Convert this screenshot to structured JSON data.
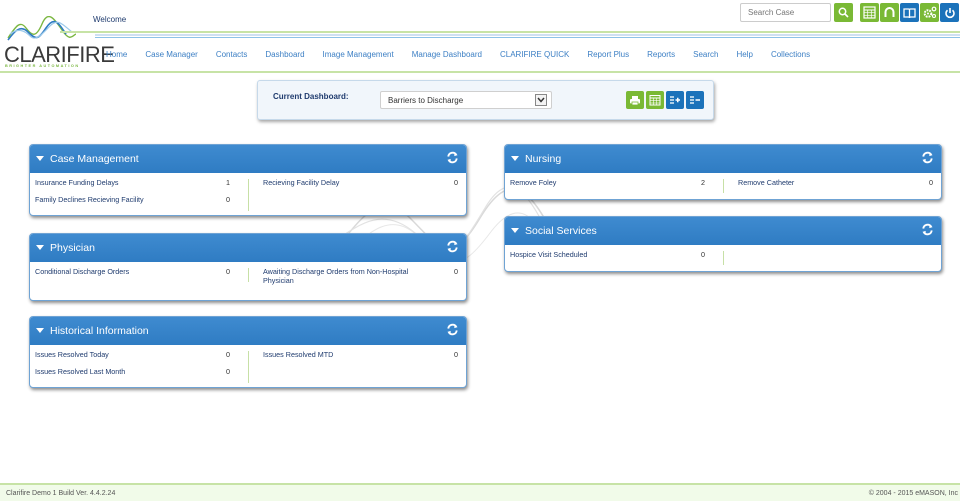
{
  "header": {
    "logo_text": "CLARIFIRE",
    "logo_tagline": "BRIGHTER AUTOMATION",
    "welcome": "Welcome",
    "search_placeholder": "Search Case",
    "toolbar_icons": [
      {
        "name": "search-icon",
        "color": "#7ab935"
      },
      {
        "name": "calculator-icon",
        "color": "#7ab935"
      },
      {
        "name": "headset-icon",
        "color": "#7ab935"
      },
      {
        "name": "book-icon",
        "color": "#1b72ba"
      },
      {
        "name": "settings-icon",
        "color": "#7ab935"
      },
      {
        "name": "power-icon",
        "color": "#1b72ba"
      }
    ]
  },
  "nav": {
    "items": [
      "Home",
      "Case Manager",
      "Contacts",
      "Dashboard",
      "Image Management",
      "Manage Dashboard",
      "CLARIFIRE QUICK",
      "Report Plus",
      "Reports",
      "Search",
      "Help",
      "Collections"
    ]
  },
  "dashboard": {
    "label": "Current Dashboard:",
    "selected": "Barriers to Discharge"
  },
  "panels": {
    "case_management": {
      "title": "Case Management",
      "left": [
        {
          "label": "Insurance Funding Delays",
          "value": "1"
        },
        {
          "label": "Family Declines Recieving Facility",
          "value": "0"
        }
      ],
      "right": [
        {
          "label": "Recieving Facility Delay",
          "value": "0"
        }
      ]
    },
    "physician": {
      "title": "Physician",
      "left": [
        {
          "label": "Conditional Discharge Orders",
          "value": "0"
        }
      ],
      "right": [
        {
          "label": "Awaiting Discharge Orders from Non-Hospital",
          "label2": "Physician",
          "value": "0"
        }
      ]
    },
    "historical": {
      "title": "Historical Information",
      "left": [
        {
          "label": "Issues Resolved Today",
          "value": "0"
        },
        {
          "label": "Issues Resolved Last Month",
          "value": "0"
        }
      ],
      "right": [
        {
          "label": "Issues Resolved MTD",
          "value": "0"
        }
      ]
    },
    "nursing": {
      "title": "Nursing",
      "left": [
        {
          "label": "Remove Foley",
          "value": "2"
        }
      ],
      "right": [
        {
          "label": "Remove Catheter",
          "value": "0"
        }
      ]
    },
    "social_services": {
      "title": "Social Services",
      "left": [
        {
          "label": "Hospice Visit Scheduled",
          "value": "0"
        }
      ],
      "right": []
    }
  },
  "footer": {
    "left": "Clarifire Demo 1   Build Ver. 4.4.2.24",
    "right": "©  2004 - 2015 eMASON, Inc"
  },
  "colors": {
    "brand_green": "#7ab935",
    "brand_blue": "#1b72ba",
    "panel_header": "#3584c9",
    "link_text": "#3c7fc4"
  }
}
